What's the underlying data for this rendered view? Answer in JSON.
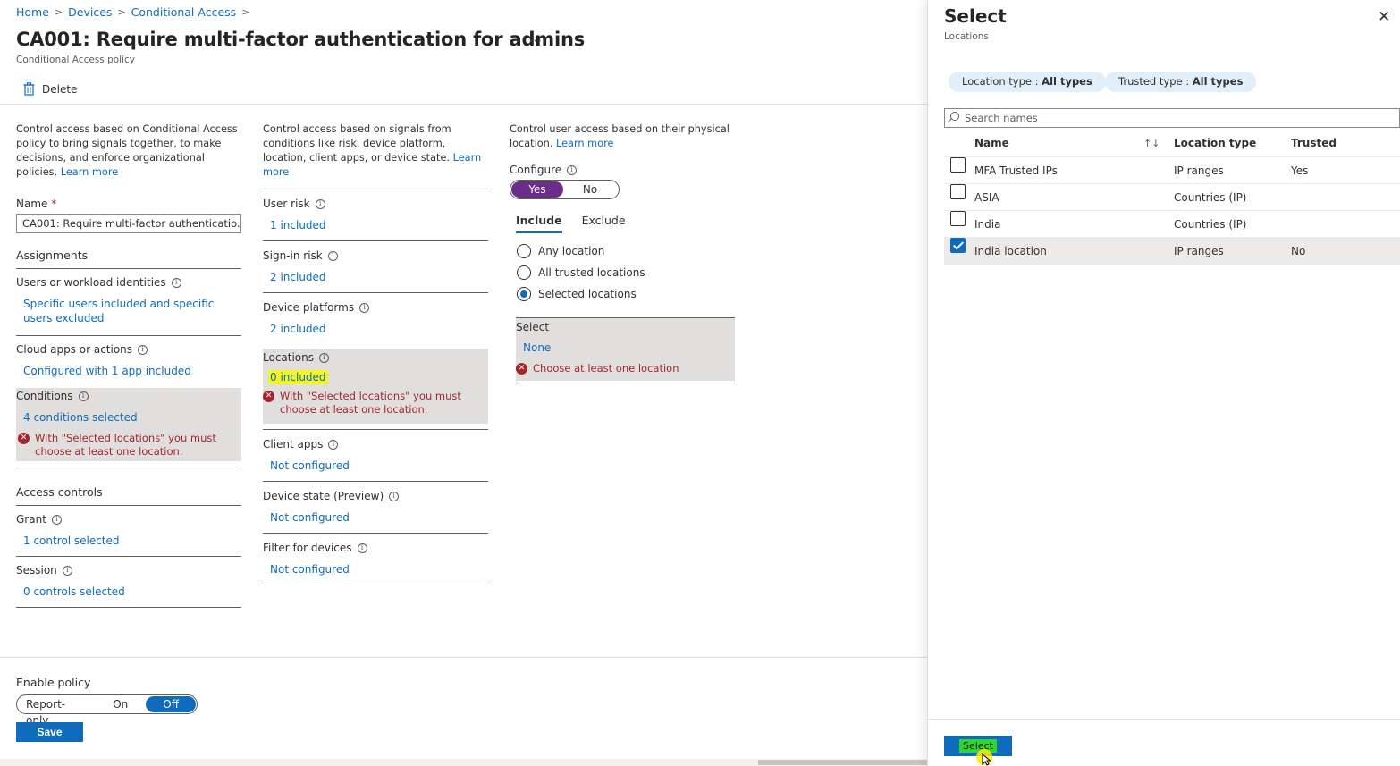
{
  "breadcrumb": [
    {
      "label": "Home"
    },
    {
      "label": "Devices"
    },
    {
      "label": "Conditional Access"
    }
  ],
  "header": {
    "title": "CA001: Require multi-factor authentication for admins",
    "more": "···",
    "subtitle": "Conditional Access policy",
    "delete_label": "Delete"
  },
  "left": {
    "description": "Control access based on Conditional Access policy to bring signals together, to make decisions, and enforce organizational policies.",
    "learn_more": "Learn more",
    "name_label": "Name",
    "name_required": "*",
    "name_value": "CA001: Require multi-factor authenticatio...",
    "assignments": "Assignments",
    "users_label": "Users or workload identities",
    "users_value": "Specific users included and specific users excluded",
    "cloud_label": "Cloud apps or actions",
    "cloud_value": "Configured with 1 app included",
    "conditions_label": "Conditions",
    "conditions_value": "4 conditions selected",
    "conditions_error": "With \"Selected locations\" you must choose at least one location.",
    "access_controls": "Access controls",
    "grant_label": "Grant",
    "grant_value": "1 control selected",
    "session_label": "Session",
    "session_value": "0 controls selected"
  },
  "middle": {
    "description": "Control access based on signals from conditions like risk, device platform, location, client apps, or device state.",
    "learn_more": "Learn more",
    "user_risk_label": "User risk",
    "user_risk_value": "1 included",
    "signin_risk_label": "Sign-in risk",
    "signin_risk_value": "2 included",
    "device_platforms_label": "Device platforms",
    "device_platforms_value": "2 included",
    "locations_label": "Locations",
    "locations_value": "0 included",
    "locations_error": "With \"Selected locations\" you must choose at least one location.",
    "client_apps_label": "Client apps",
    "client_apps_value": "Not configured",
    "device_state_label": "Device state (Preview)",
    "device_state_value": "Not configured",
    "filter_devices_label": "Filter for devices",
    "filter_devices_value": "Not configured"
  },
  "right_col": {
    "description": "Control user access based on their physical location.",
    "learn_more": "Learn more",
    "configure_label": "Configure",
    "yes": "Yes",
    "no": "No",
    "tab_include": "Include",
    "tab_exclude": "Exclude",
    "radio_any": "Any location",
    "radio_trusted": "All trusted locations",
    "radio_selected": "Selected locations",
    "select_label": "Select",
    "select_value": "None",
    "select_error": "Choose at least one location"
  },
  "footer": {
    "enable_policy": "Enable policy",
    "report_only": "Report-only",
    "on": "On",
    "off": "Off",
    "save": "Save"
  },
  "panel": {
    "title": "Select",
    "subtitle": "Locations",
    "chip1_label": "Location type : ",
    "chip1_value": "All types",
    "chip2_label": "Trusted type : ",
    "chip2_value": "All types",
    "search_placeholder": "Search names",
    "col_name": "Name",
    "col_sort": "↑↓",
    "col_type": "Location type",
    "col_trusted": "Trusted",
    "rows": [
      {
        "name": "MFA Trusted IPs",
        "type": "IP ranges",
        "trusted": "Yes",
        "checked": false
      },
      {
        "name": "ASIA",
        "type": "Countries (IP)",
        "trusted": "",
        "checked": false
      },
      {
        "name": "India",
        "type": "Countries (IP)",
        "trusted": "",
        "checked": false
      },
      {
        "name": "India location",
        "type": "IP ranges",
        "trusted": "No",
        "checked": true
      }
    ],
    "select_button": "Select"
  },
  "colors": {
    "accent": "#0f6cbd",
    "toggle_purple": "#6b2c8c",
    "error": "#a4262c",
    "highlight_yellow": "#f5f524",
    "highlight_green": "#2fd62f"
  }
}
